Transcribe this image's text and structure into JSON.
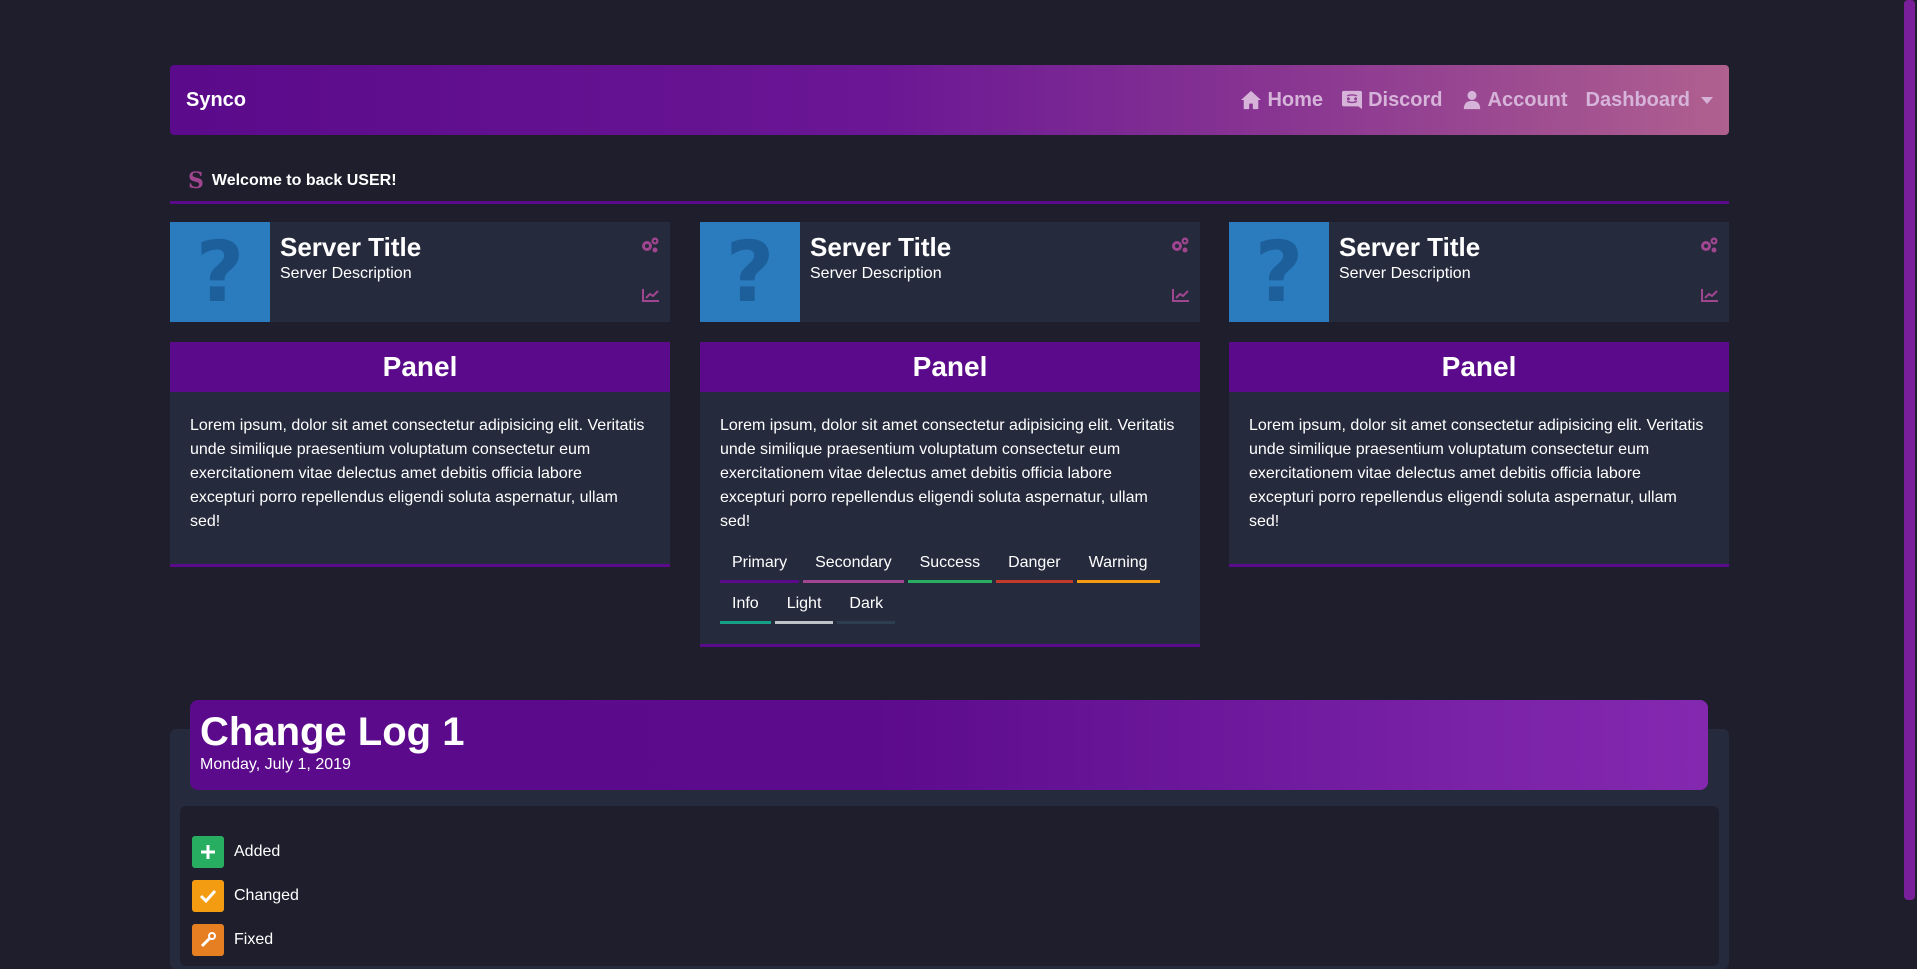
{
  "navbar": {
    "brand": "Synco",
    "links": [
      {
        "label": "Home",
        "icon": "home-icon"
      },
      {
        "label": "Discord",
        "icon": "discord-icon"
      },
      {
        "label": "Account",
        "icon": "user-icon"
      },
      {
        "label": "Dashboard",
        "icon": "caret-down-icon"
      }
    ]
  },
  "welcome": {
    "logo": "S",
    "text": "Welcome to back USER!"
  },
  "servers": [
    {
      "icon": "?",
      "title": "Server Title",
      "description": "Server Description"
    },
    {
      "icon": "?",
      "title": "Server Title",
      "description": "Server Description"
    },
    {
      "icon": "?",
      "title": "Server Title",
      "description": "Server Description"
    }
  ],
  "panels": [
    {
      "title": "Panel",
      "text": "Lorem ipsum, dolor sit amet consectetur adipisicing elit. Veritatis unde similique praesentium voluptatum consectetur eum exercitationem vitae delectus amet debitis officia labore excepturi porro repellendus eligendi soluta aspernatur, ullam sed!"
    },
    {
      "title": "Panel",
      "text": "Lorem ipsum, dolor sit amet consectetur adipisicing elit. Veritatis unde similique praesentium voluptatum consectetur eum exercitationem vitae delectus amet debitis officia labore excepturi porro repellendus eligendi soluta aspernatur, ullam sed!"
    },
    {
      "title": "Panel",
      "text": "Lorem ipsum, dolor sit amet consectetur adipisicing elit. Veritatis unde similique praesentium voluptatum consectetur eum exercitationem vitae delectus amet debitis officia labore excepturi porro repellendus eligendi soluta aspernatur, ullam sed!"
    }
  ],
  "tags": [
    {
      "label": "Primary",
      "color": "#5a0a8a"
    },
    {
      "label": "Secondary",
      "color": "#a0458f"
    },
    {
      "label": "Success",
      "color": "#27ae60"
    },
    {
      "label": "Danger",
      "color": "#c0392b"
    },
    {
      "label": "Warning",
      "color": "#f39c12"
    },
    {
      "label": "Info",
      "color": "#16a085"
    },
    {
      "label": "Light",
      "color": "#bdc3c7"
    },
    {
      "label": "Dark",
      "color": "#2c3e50"
    }
  ],
  "changelog": {
    "title": "Change Log 1",
    "date": "Monday, July 1, 2019",
    "items": [
      {
        "label": "Added",
        "icon": "plus-icon",
        "color": "#27ae60"
      },
      {
        "label": "Changed",
        "icon": "check-icon",
        "color": "#f39c12"
      },
      {
        "label": "Fixed",
        "icon": "wrench-icon",
        "color": "#e67e22"
      }
    ]
  },
  "colors": {
    "accent": "#5a0a8a",
    "secondary": "#a0458f",
    "background": "#1e1e2d",
    "card": "#262a3d"
  }
}
